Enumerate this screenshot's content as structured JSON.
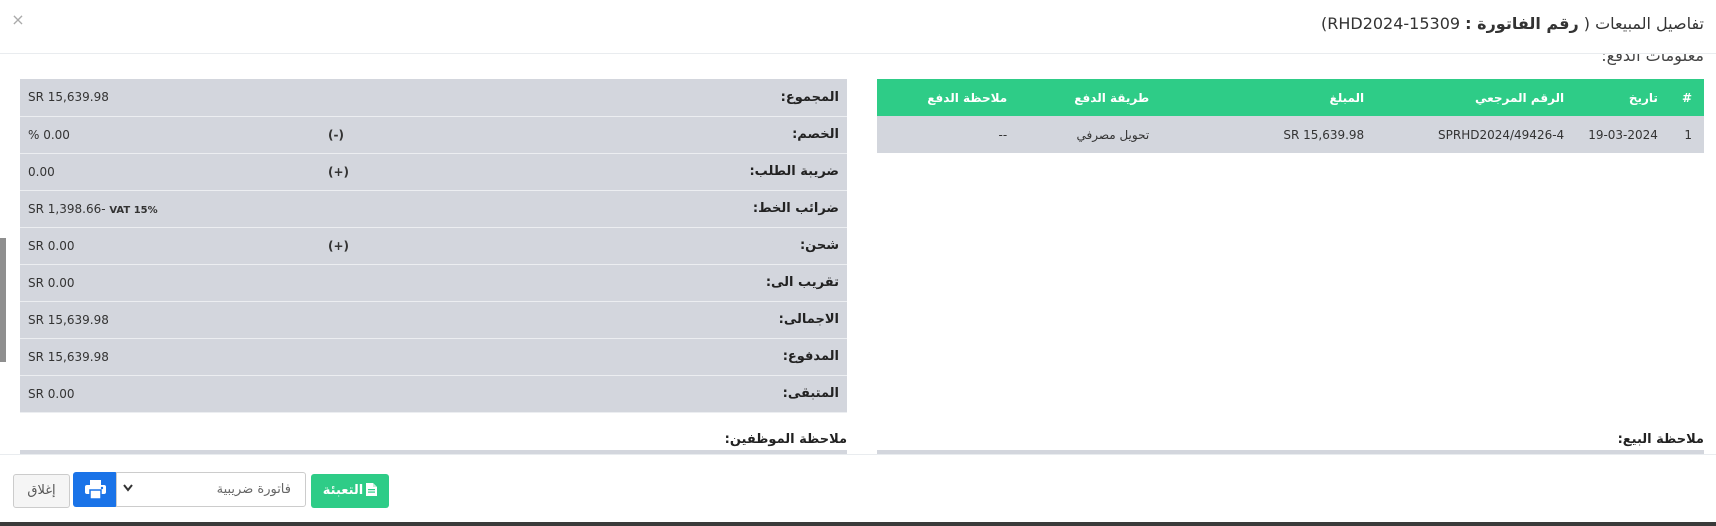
{
  "header": {
    "title_prefix": "تفاصيل المبيعات (",
    "title_label": "رقم الفاتورة :",
    "title_number": "RHD2024-15309)",
    "close_glyph": "×"
  },
  "payment_section": {
    "title": "معلومات الدفع:",
    "columns": [
      "#",
      "تاريخ",
      "الرقم المرجعي",
      "المبلغ",
      "طريقة الدفع",
      "ملاحظة الدفع"
    ],
    "rows": [
      {
        "index": "1",
        "date": "19-03-2024",
        "reference": "SPRHD2024/49426-4",
        "amount": "SR 15,639.98",
        "method": "تحويل مصرفي",
        "note": "--"
      }
    ]
  },
  "totals": {
    "rows": [
      {
        "label": "المجموع:",
        "sign": "",
        "value": "SR 15,639.98"
      },
      {
        "label": "الخصم:",
        "sign": "(-)",
        "value": "% 0.00"
      },
      {
        "label": "ضريبة الطلب:",
        "sign": "(+)",
        "value": "0.00"
      },
      {
        "label": "ضرائب الخط:",
        "sign": "",
        "value": "SR 1,398.66-",
        "value_suffix": "VAT 15%"
      },
      {
        "label": "شحن:",
        "sign": "(+)",
        "value": "SR 0.00"
      },
      {
        "label": "تقريب الى:",
        "sign": "",
        "value": "SR 0.00"
      },
      {
        "label": "الاجمالى:",
        "sign": "",
        "value": "SR 15,639.98"
      },
      {
        "label": "المدفوع:",
        "sign": "",
        "value": "SR 15,639.98"
      },
      {
        "label": "المتبقى:",
        "sign": "",
        "value": "SR 0.00"
      }
    ]
  },
  "notes": {
    "sale_note_label": "ملاحظة البيع:",
    "staff_note_label": "ملاحظة الموظفين:"
  },
  "footer": {
    "close_label": "إغلاق",
    "invoice_select_value": "فاتورة ضريبية",
    "fill_label": "التعبئة",
    "print_icon": "printer-icon"
  },
  "colors": {
    "accent_green": "#2ecc87",
    "primary_blue": "#1a73e8",
    "row_gray": "#d3d6dd"
  }
}
